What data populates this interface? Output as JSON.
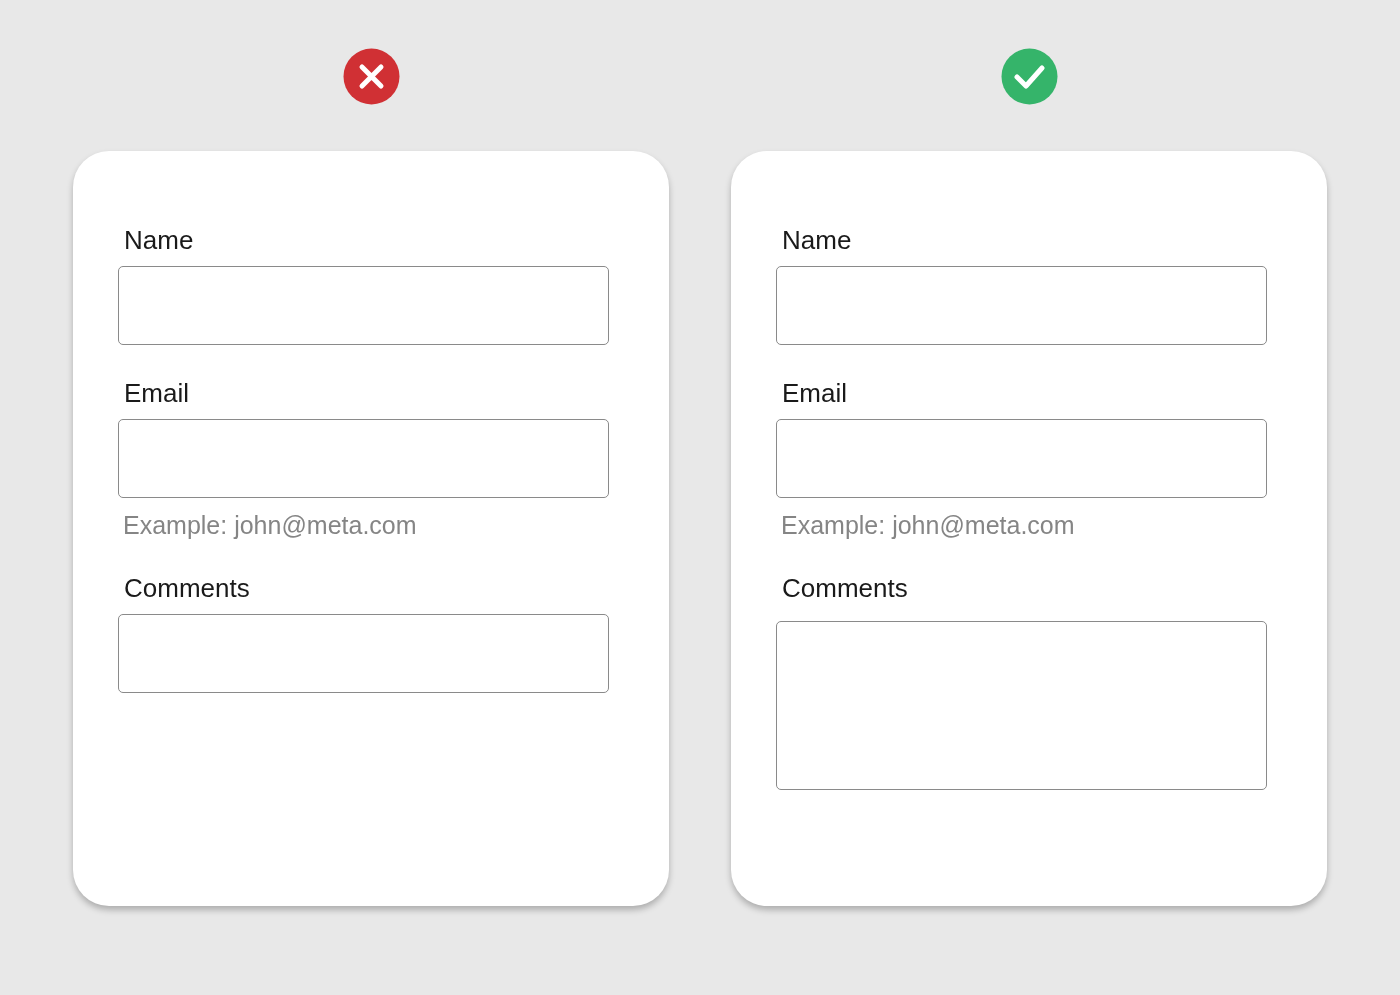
{
  "panels": [
    {
      "kind": "bad",
      "fields": [
        {
          "label": "Name",
          "kind": "single"
        },
        {
          "label": "Email",
          "kind": "single",
          "hint": "Example: john@meta.com"
        },
        {
          "label": "Comments",
          "kind": "single"
        }
      ]
    },
    {
      "kind": "good",
      "fields": [
        {
          "label": "Name",
          "kind": "single"
        },
        {
          "label": "Email",
          "kind": "single",
          "hint": "Example: john@meta.com"
        },
        {
          "label": "Comments",
          "kind": "multi"
        }
      ]
    }
  ]
}
